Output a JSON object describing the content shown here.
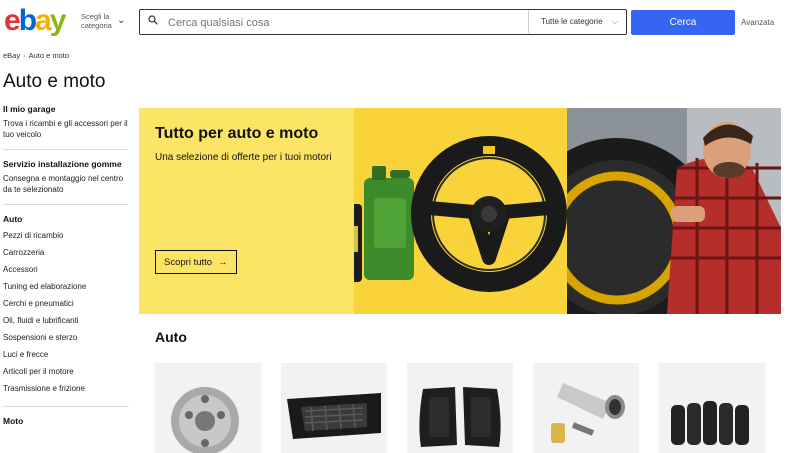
{
  "header": {
    "logo_letters": [
      "e",
      "b",
      "a",
      "y"
    ],
    "category_picker_label": "Scegli la categoria",
    "search_placeholder": "Cerca qualsiasi cosa",
    "category_select_value": "Tutte le categorie",
    "search_button_label": "Cerca",
    "advanced_label": "Avanzata"
  },
  "breadcrumb": [
    "eBay",
    "Auto e moto"
  ],
  "page_title": "Auto e moto",
  "sidebar": {
    "garage_heading": "Il mio garage",
    "garage_text": "Trova i ricambi e gli accessori per il tuo veicolo",
    "install_heading": "Servizio installazione gomme",
    "install_text": "Consegna e montaggio nel centro da te selezionato",
    "auto_heading": "Auto",
    "auto_items": [
      "Pezzi di ricambio",
      "Carrozzeria",
      "Accessori",
      "Tuning ed elaborazione",
      "Cerchi e pneumatici",
      "Oli, fluidi e lubrificanti",
      "Sospensioni e sterzo",
      "Luci e frecce",
      "Articoli per il motore",
      "Trasmissione e frizione"
    ],
    "moto_heading": "Moto"
  },
  "banner": {
    "title": "Tutto per auto e moto",
    "subtitle": "Una selezione di offerte per i tuoi motori",
    "cta_label": "Scopri tutto"
  },
  "section": {
    "title": "Auto",
    "cards": [
      "clutch-kit",
      "front-grille",
      "car-floor-mats",
      "exhaust-tips",
      "tires-stack"
    ]
  },
  "colors": {
    "search_button": "#3665f3",
    "banner_yellow_light": "#fbe466",
    "banner_yellow": "#f9d33a"
  }
}
